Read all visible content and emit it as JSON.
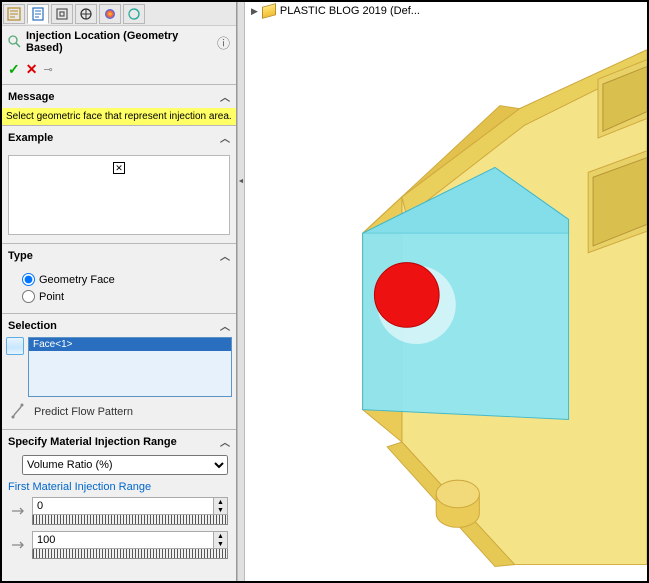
{
  "tree": {
    "item_label": "PLASTIC BLOG 2019 (Def..."
  },
  "panel": {
    "title": "Injection Location (Geometry Based)",
    "message_header": "Message",
    "message_text": "Select geometric face that represent injection area.",
    "example_header": "Example",
    "type_header": "Type",
    "type_options": {
      "geometry_face": "Geometry Face",
      "point": "Point"
    },
    "selection_header": "Selection",
    "selection_items": [
      "Face<1>"
    ],
    "predict_label": "Predict Flow Pattern",
    "range_header": "Specify Material Injection Range",
    "range_dropdown": "Volume Ratio (%)",
    "first_range_label": "First Material Injection Range",
    "range_start": "0",
    "range_end": "100"
  }
}
